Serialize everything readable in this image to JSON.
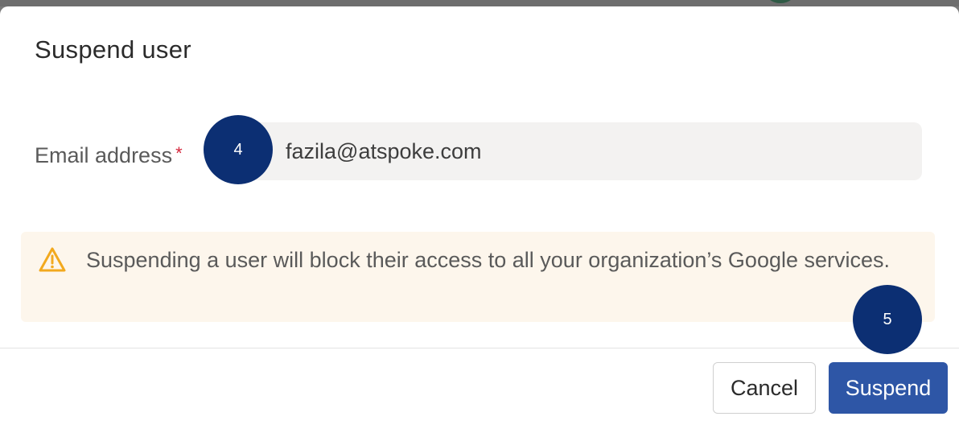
{
  "dialog": {
    "title": "Suspend user",
    "email_label": "Email address",
    "required_mark": "*",
    "email_value": "fazila@atspoke.com",
    "warning_icon": "warning-triangle-icon",
    "warning_text": "Suspending a user will block their access to all your organization’s Google services.",
    "cancel_label": "Cancel",
    "suspend_label": "Suspend"
  },
  "markers": {
    "email": "4",
    "suspend": "5"
  },
  "colors": {
    "primary": "#2e56a6",
    "marker": "#0c2f73",
    "required": "#d4263c",
    "warning_icon": "#f2a91e",
    "warning_bg": "#fdf6ec"
  }
}
